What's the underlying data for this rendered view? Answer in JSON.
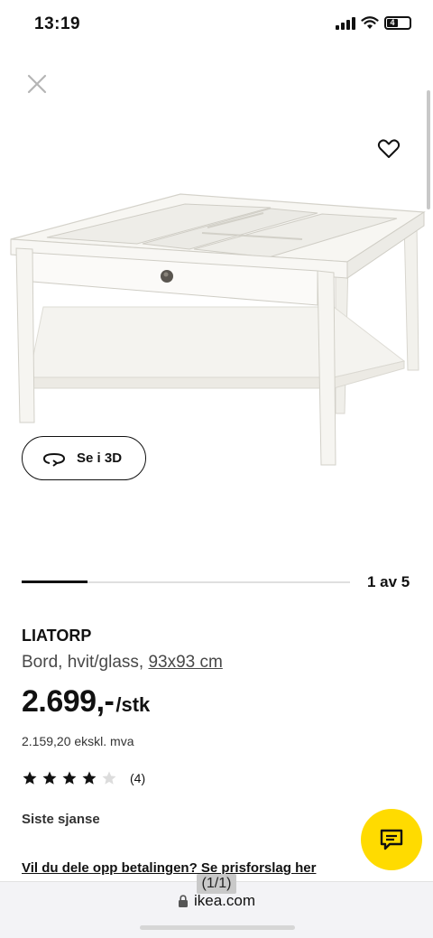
{
  "status": {
    "time": "13:19",
    "battery": "4"
  },
  "product": {
    "name": "LIATORP",
    "description": "Bord, hvit/glass, ",
    "dimensions": "93x93 cm",
    "price": "2.699,-",
    "price_unit": "/stk",
    "excl_vat": "2.159,20 ekskl. mva",
    "rating": {
      "stars": 4,
      "max": 5,
      "count": "(4)"
    },
    "availability": "Siste sjanse",
    "payment_link": "Vil du dele opp betalingen? Se prisforslag her"
  },
  "gallery": {
    "view3d_label": "Se i 3D",
    "pager": "1 av 5",
    "progress_fraction": 0.2
  },
  "browser": {
    "tab_counter": "(1/1)",
    "url": "ikea.com"
  },
  "colors": {
    "accent_yellow": "#ffdb00",
    "text": "#111111"
  }
}
